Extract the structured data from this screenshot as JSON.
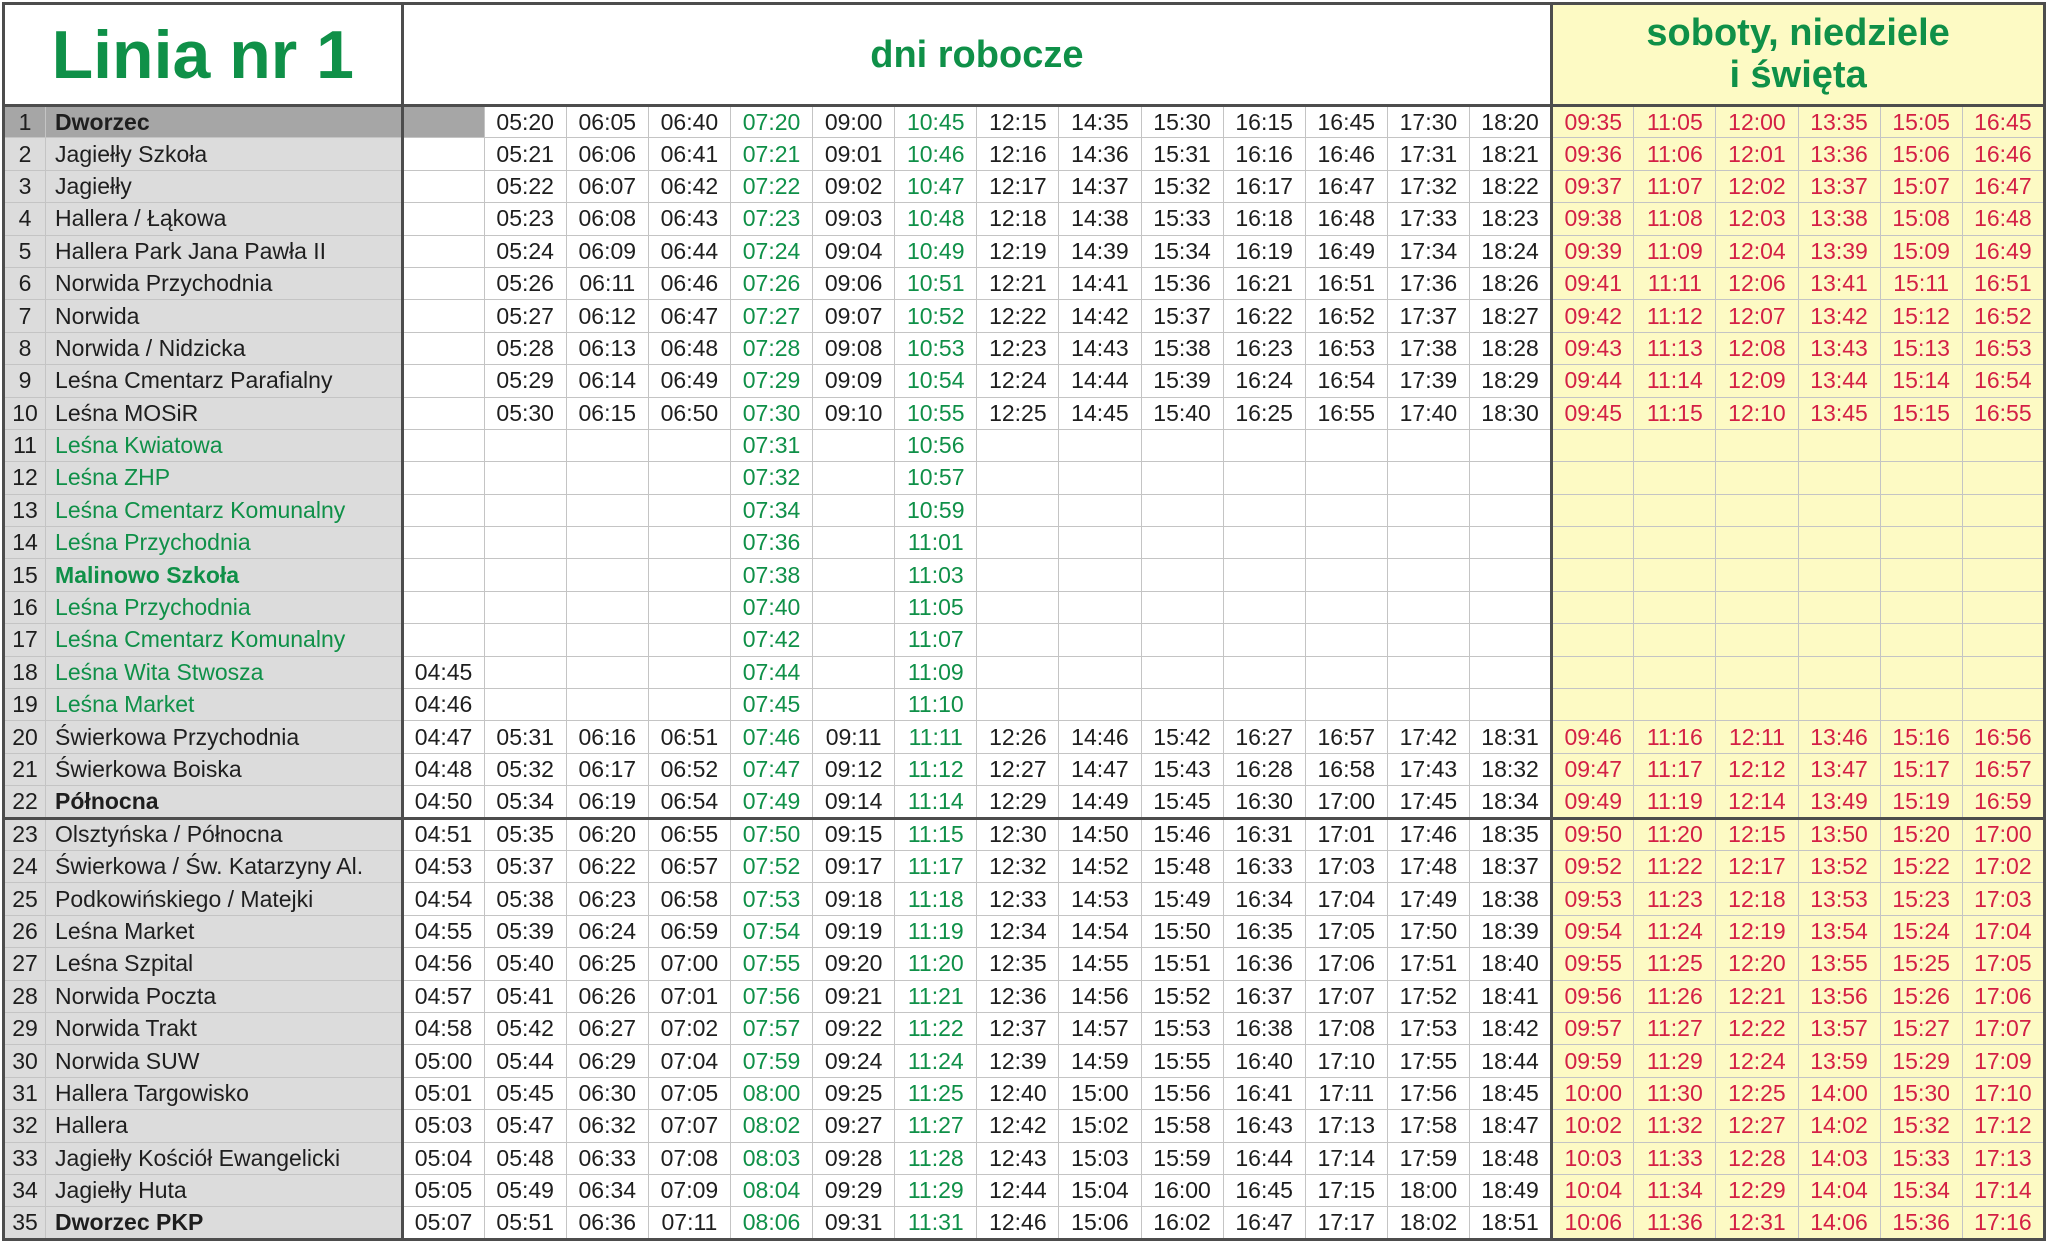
{
  "title": "Linia nr 1",
  "header_weekdays": "dni robocze",
  "header_weekend_line1": "soboty, niedziele",
  "header_weekend_line2": "i święta",
  "colors": {
    "green": "#0f9048",
    "red": "#d42045",
    "weekend_bg": "#fdfac4",
    "stop_bg": "#dcdcdc",
    "first_row_bg": "#a6a6a6"
  },
  "rows": [
    {
      "n": "1",
      "name": "Dworzec",
      "bold": true,
      "green": false,
      "wd": [
        "",
        "05:20",
        "06:05",
        "06:40",
        "07:20",
        "09:00",
        "10:45",
        "12:15",
        "14:35",
        "15:30",
        "16:15",
        "16:45",
        "17:30",
        "18:20"
      ],
      "we": [
        "09:35",
        "11:05",
        "12:00",
        "13:35",
        "15:05",
        "16:45"
      ]
    },
    {
      "n": "2",
      "name": "Jagiełły Szkoła",
      "bold": false,
      "green": false,
      "wd": [
        "",
        "05:21",
        "06:06",
        "06:41",
        "07:21",
        "09:01",
        "10:46",
        "12:16",
        "14:36",
        "15:31",
        "16:16",
        "16:46",
        "17:31",
        "18:21"
      ],
      "we": [
        "09:36",
        "11:06",
        "12:01",
        "13:36",
        "15:06",
        "16:46"
      ]
    },
    {
      "n": "3",
      "name": "Jagiełły",
      "bold": false,
      "green": false,
      "wd": [
        "",
        "05:22",
        "06:07",
        "06:42",
        "07:22",
        "09:02",
        "10:47",
        "12:17",
        "14:37",
        "15:32",
        "16:17",
        "16:47",
        "17:32",
        "18:22"
      ],
      "we": [
        "09:37",
        "11:07",
        "12:02",
        "13:37",
        "15:07",
        "16:47"
      ]
    },
    {
      "n": "4",
      "name": "Hallera / Łąkowa",
      "bold": false,
      "green": false,
      "wd": [
        "",
        "05:23",
        "06:08",
        "06:43",
        "07:23",
        "09:03",
        "10:48",
        "12:18",
        "14:38",
        "15:33",
        "16:18",
        "16:48",
        "17:33",
        "18:23"
      ],
      "we": [
        "09:38",
        "11:08",
        "12:03",
        "13:38",
        "15:08",
        "16:48"
      ]
    },
    {
      "n": "5",
      "name": "Hallera Park Jana Pawła II",
      "bold": false,
      "green": false,
      "wd": [
        "",
        "05:24",
        "06:09",
        "06:44",
        "07:24",
        "09:04",
        "10:49",
        "12:19",
        "14:39",
        "15:34",
        "16:19",
        "16:49",
        "17:34",
        "18:24"
      ],
      "we": [
        "09:39",
        "11:09",
        "12:04",
        "13:39",
        "15:09",
        "16:49"
      ]
    },
    {
      "n": "6",
      "name": "Norwida Przychodnia",
      "bold": false,
      "green": false,
      "wd": [
        "",
        "05:26",
        "06:11",
        "06:46",
        "07:26",
        "09:06",
        "10:51",
        "12:21",
        "14:41",
        "15:36",
        "16:21",
        "16:51",
        "17:36",
        "18:26"
      ],
      "we": [
        "09:41",
        "11:11",
        "12:06",
        "13:41",
        "15:11",
        "16:51"
      ]
    },
    {
      "n": "7",
      "name": "Norwida",
      "bold": false,
      "green": false,
      "wd": [
        "",
        "05:27",
        "06:12",
        "06:47",
        "07:27",
        "09:07",
        "10:52",
        "12:22",
        "14:42",
        "15:37",
        "16:22",
        "16:52",
        "17:37",
        "18:27"
      ],
      "we": [
        "09:42",
        "11:12",
        "12:07",
        "13:42",
        "15:12",
        "16:52"
      ]
    },
    {
      "n": "8",
      "name": "Norwida / Nidzicka",
      "bold": false,
      "green": false,
      "wd": [
        "",
        "05:28",
        "06:13",
        "06:48",
        "07:28",
        "09:08",
        "10:53",
        "12:23",
        "14:43",
        "15:38",
        "16:23",
        "16:53",
        "17:38",
        "18:28"
      ],
      "we": [
        "09:43",
        "11:13",
        "12:08",
        "13:43",
        "15:13",
        "16:53"
      ]
    },
    {
      "n": "9",
      "name": "Leśna Cmentarz Parafialny",
      "bold": false,
      "green": false,
      "wd": [
        "",
        "05:29",
        "06:14",
        "06:49",
        "07:29",
        "09:09",
        "10:54",
        "12:24",
        "14:44",
        "15:39",
        "16:24",
        "16:54",
        "17:39",
        "18:29"
      ],
      "we": [
        "09:44",
        "11:14",
        "12:09",
        "13:44",
        "15:14",
        "16:54"
      ]
    },
    {
      "n": "10",
      "name": "Leśna MOSiR",
      "bold": false,
      "green": false,
      "wd": [
        "",
        "05:30",
        "06:15",
        "06:50",
        "07:30",
        "09:10",
        "10:55",
        "12:25",
        "14:45",
        "15:40",
        "16:25",
        "16:55",
        "17:40",
        "18:30"
      ],
      "we": [
        "09:45",
        "11:15",
        "12:10",
        "13:45",
        "15:15",
        "16:55"
      ]
    },
    {
      "n": "11",
      "name": "Leśna Kwiatowa",
      "bold": false,
      "green": true,
      "wd": [
        "",
        "",
        "",
        "",
        "07:31",
        "",
        "10:56",
        "",
        "",
        "",
        "",
        "",
        "",
        ""
      ],
      "we": [
        "",
        "",
        "",
        "",
        "",
        ""
      ]
    },
    {
      "n": "12",
      "name": "Leśna ZHP",
      "bold": false,
      "green": true,
      "wd": [
        "",
        "",
        "",
        "",
        "07:32",
        "",
        "10:57",
        "",
        "",
        "",
        "",
        "",
        "",
        ""
      ],
      "we": [
        "",
        "",
        "",
        "",
        "",
        ""
      ]
    },
    {
      "n": "13",
      "name": "Leśna Cmentarz Komunalny",
      "bold": false,
      "green": true,
      "wd": [
        "",
        "",
        "",
        "",
        "07:34",
        "",
        "10:59",
        "",
        "",
        "",
        "",
        "",
        "",
        ""
      ],
      "we": [
        "",
        "",
        "",
        "",
        "",
        ""
      ]
    },
    {
      "n": "14",
      "name": "Leśna Przychodnia",
      "bold": false,
      "green": true,
      "wd": [
        "",
        "",
        "",
        "",
        "07:36",
        "",
        "11:01",
        "",
        "",
        "",
        "",
        "",
        "",
        ""
      ],
      "we": [
        "",
        "",
        "",
        "",
        "",
        ""
      ]
    },
    {
      "n": "15",
      "name": "Malinowo Szkoła",
      "bold": true,
      "green": true,
      "wd": [
        "",
        "",
        "",
        "",
        "07:38",
        "",
        "11:03",
        "",
        "",
        "",
        "",
        "",
        "",
        ""
      ],
      "we": [
        "",
        "",
        "",
        "",
        "",
        ""
      ]
    },
    {
      "n": "16",
      "name": "Leśna Przychodnia",
      "bold": false,
      "green": true,
      "wd": [
        "",
        "",
        "",
        "",
        "07:40",
        "",
        "11:05",
        "",
        "",
        "",
        "",
        "",
        "",
        ""
      ],
      "we": [
        "",
        "",
        "",
        "",
        "",
        ""
      ]
    },
    {
      "n": "17",
      "name": "Leśna Cmentarz Komunalny",
      "bold": false,
      "green": true,
      "wd": [
        "",
        "",
        "",
        "",
        "07:42",
        "",
        "11:07",
        "",
        "",
        "",
        "",
        "",
        "",
        ""
      ],
      "we": [
        "",
        "",
        "",
        "",
        "",
        ""
      ]
    },
    {
      "n": "18",
      "name": "Leśna Wita Stwosza",
      "bold": false,
      "green": true,
      "wd": [
        "04:45",
        "",
        "",
        "",
        "07:44",
        "",
        "11:09",
        "",
        "",
        "",
        "",
        "",
        "",
        ""
      ],
      "we": [
        "",
        "",
        "",
        "",
        "",
        ""
      ]
    },
    {
      "n": "19",
      "name": "Leśna Market",
      "bold": false,
      "green": true,
      "wd": [
        "04:46",
        "",
        "",
        "",
        "07:45",
        "",
        "11:10",
        "",
        "",
        "",
        "",
        "",
        "",
        ""
      ],
      "we": [
        "",
        "",
        "",
        "",
        "",
        ""
      ]
    },
    {
      "n": "20",
      "name": "Świerkowa Przychodnia",
      "bold": false,
      "green": false,
      "wd": [
        "04:47",
        "05:31",
        "06:16",
        "06:51",
        "07:46",
        "09:11",
        "11:11",
        "12:26",
        "14:46",
        "15:42",
        "16:27",
        "16:57",
        "17:42",
        "18:31"
      ],
      "we": [
        "09:46",
        "11:16",
        "12:11",
        "13:46",
        "15:16",
        "16:56"
      ]
    },
    {
      "n": "21",
      "name": "Świerkowa Boiska",
      "bold": false,
      "green": false,
      "wd": [
        "04:48",
        "05:32",
        "06:17",
        "06:52",
        "07:47",
        "09:12",
        "11:12",
        "12:27",
        "14:47",
        "15:43",
        "16:28",
        "16:58",
        "17:43",
        "18:32"
      ],
      "we": [
        "09:47",
        "11:17",
        "12:12",
        "13:47",
        "15:17",
        "16:57"
      ]
    },
    {
      "n": "22",
      "name": "Północna",
      "bold": true,
      "green": false,
      "wd": [
        "04:50",
        "05:34",
        "06:19",
        "06:54",
        "07:49",
        "09:14",
        "11:14",
        "12:29",
        "14:49",
        "15:45",
        "16:30",
        "17:00",
        "17:45",
        "18:34"
      ],
      "we": [
        "09:49",
        "11:19",
        "12:14",
        "13:49",
        "15:19",
        "16:59"
      ]
    },
    {
      "n": "23",
      "name": "Olsztyńska / Północna",
      "bold": false,
      "green": false,
      "wd": [
        "04:51",
        "05:35",
        "06:20",
        "06:55",
        "07:50",
        "09:15",
        "11:15",
        "12:30",
        "14:50",
        "15:46",
        "16:31",
        "17:01",
        "17:46",
        "18:35"
      ],
      "we": [
        "09:50",
        "11:20",
        "12:15",
        "13:50",
        "15:20",
        "17:00"
      ]
    },
    {
      "n": "24",
      "name": "Świerkowa / Św. Katarzyny Al.",
      "bold": false,
      "green": false,
      "wd": [
        "04:53",
        "05:37",
        "06:22",
        "06:57",
        "07:52",
        "09:17",
        "11:17",
        "12:32",
        "14:52",
        "15:48",
        "16:33",
        "17:03",
        "17:48",
        "18:37"
      ],
      "we": [
        "09:52",
        "11:22",
        "12:17",
        "13:52",
        "15:22",
        "17:02"
      ]
    },
    {
      "n": "25",
      "name": "Podkowińskiego / Matejki",
      "bold": false,
      "green": false,
      "wd": [
        "04:54",
        "05:38",
        "06:23",
        "06:58",
        "07:53",
        "09:18",
        "11:18",
        "12:33",
        "14:53",
        "15:49",
        "16:34",
        "17:04",
        "17:49",
        "18:38"
      ],
      "we": [
        "09:53",
        "11:23",
        "12:18",
        "13:53",
        "15:23",
        "17:03"
      ]
    },
    {
      "n": "26",
      "name": "Leśna Market",
      "bold": false,
      "green": false,
      "wd": [
        "04:55",
        "05:39",
        "06:24",
        "06:59",
        "07:54",
        "09:19",
        "11:19",
        "12:34",
        "14:54",
        "15:50",
        "16:35",
        "17:05",
        "17:50",
        "18:39"
      ],
      "we": [
        "09:54",
        "11:24",
        "12:19",
        "13:54",
        "15:24",
        "17:04"
      ]
    },
    {
      "n": "27",
      "name": "Leśna Szpital",
      "bold": false,
      "green": false,
      "wd": [
        "04:56",
        "05:40",
        "06:25",
        "07:00",
        "07:55",
        "09:20",
        "11:20",
        "12:35",
        "14:55",
        "15:51",
        "16:36",
        "17:06",
        "17:51",
        "18:40"
      ],
      "we": [
        "09:55",
        "11:25",
        "12:20",
        "13:55",
        "15:25",
        "17:05"
      ]
    },
    {
      "n": "28",
      "name": "Norwida Poczta",
      "bold": false,
      "green": false,
      "wd": [
        "04:57",
        "05:41",
        "06:26",
        "07:01",
        "07:56",
        "09:21",
        "11:21",
        "12:36",
        "14:56",
        "15:52",
        "16:37",
        "17:07",
        "17:52",
        "18:41"
      ],
      "we": [
        "09:56",
        "11:26",
        "12:21",
        "13:56",
        "15:26",
        "17:06"
      ]
    },
    {
      "n": "29",
      "name": "Norwida Trakt",
      "bold": false,
      "green": false,
      "wd": [
        "04:58",
        "05:42",
        "06:27",
        "07:02",
        "07:57",
        "09:22",
        "11:22",
        "12:37",
        "14:57",
        "15:53",
        "16:38",
        "17:08",
        "17:53",
        "18:42"
      ],
      "we": [
        "09:57",
        "11:27",
        "12:22",
        "13:57",
        "15:27",
        "17:07"
      ]
    },
    {
      "n": "30",
      "name": "Norwida SUW",
      "bold": false,
      "green": false,
      "wd": [
        "05:00",
        "05:44",
        "06:29",
        "07:04",
        "07:59",
        "09:24",
        "11:24",
        "12:39",
        "14:59",
        "15:55",
        "16:40",
        "17:10",
        "17:55",
        "18:44"
      ],
      "we": [
        "09:59",
        "11:29",
        "12:24",
        "13:59",
        "15:29",
        "17:09"
      ]
    },
    {
      "n": "31",
      "name": "Hallera Targowisko",
      "bold": false,
      "green": false,
      "wd": [
        "05:01",
        "05:45",
        "06:30",
        "07:05",
        "08:00",
        "09:25",
        "11:25",
        "12:40",
        "15:00",
        "15:56",
        "16:41",
        "17:11",
        "17:56",
        "18:45"
      ],
      "we": [
        "10:00",
        "11:30",
        "12:25",
        "14:00",
        "15:30",
        "17:10"
      ]
    },
    {
      "n": "32",
      "name": "Hallera",
      "bold": false,
      "green": false,
      "wd": [
        "05:03",
        "05:47",
        "06:32",
        "07:07",
        "08:02",
        "09:27",
        "11:27",
        "12:42",
        "15:02",
        "15:58",
        "16:43",
        "17:13",
        "17:58",
        "18:47"
      ],
      "we": [
        "10:02",
        "11:32",
        "12:27",
        "14:02",
        "15:32",
        "17:12"
      ]
    },
    {
      "n": "33",
      "name": "Jagiełły Kościół Ewangelicki",
      "bold": false,
      "green": false,
      "wd": [
        "05:04",
        "05:48",
        "06:33",
        "07:08",
        "08:03",
        "09:28",
        "11:28",
        "12:43",
        "15:03",
        "15:59",
        "16:44",
        "17:14",
        "17:59",
        "18:48"
      ],
      "we": [
        "10:03",
        "11:33",
        "12:28",
        "14:03",
        "15:33",
        "17:13"
      ]
    },
    {
      "n": "34",
      "name": "Jagiełły Huta",
      "bold": false,
      "green": false,
      "wd": [
        "05:05",
        "05:49",
        "06:34",
        "07:09",
        "08:04",
        "09:29",
        "11:29",
        "12:44",
        "15:04",
        "16:00",
        "16:45",
        "17:15",
        "18:00",
        "18:49"
      ],
      "we": [
        "10:04",
        "11:34",
        "12:29",
        "14:04",
        "15:34",
        "17:14"
      ]
    },
    {
      "n": "35",
      "name": "Dworzec PKP",
      "bold": true,
      "green": false,
      "wd": [
        "05:07",
        "05:51",
        "06:36",
        "07:11",
        "08:06",
        "09:31",
        "11:31",
        "12:46",
        "15:06",
        "16:02",
        "16:47",
        "17:17",
        "18:02",
        "18:51"
      ],
      "we": [
        "10:06",
        "11:36",
        "12:31",
        "14:06",
        "15:36",
        "17:16"
      ]
    }
  ]
}
